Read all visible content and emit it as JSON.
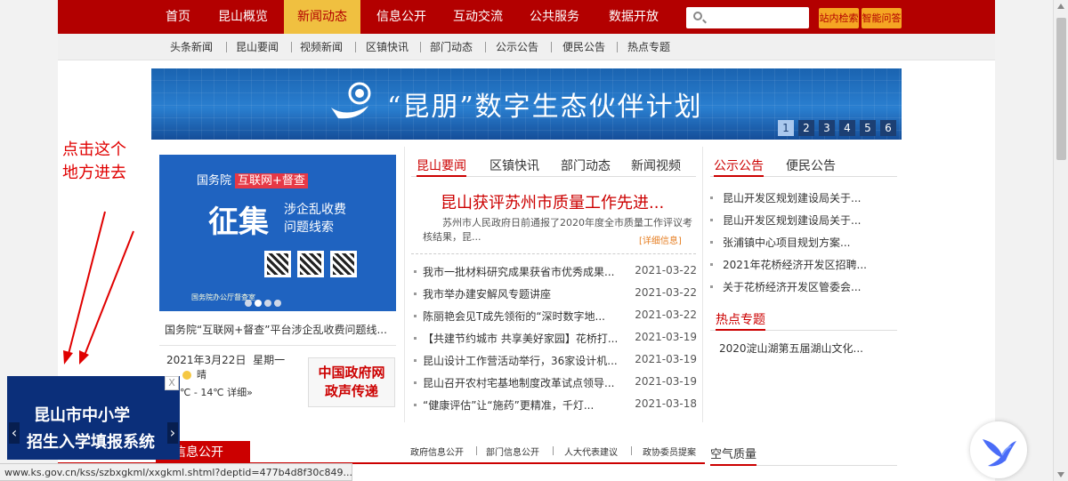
{
  "topnav": {
    "items": [
      "首页",
      "昆山概览",
      "新闻动态",
      "信息公开",
      "互动交流",
      "公共服务",
      "数据开放"
    ],
    "active_index": 2,
    "search_placeholder": "",
    "site_search": "站内检索",
    "doc_search": "智能问答"
  },
  "subnav": {
    "items": [
      "头条新闻",
      "昆山要闻",
      "视频新闻",
      "区镇快讯",
      "部门动态",
      "公示公告",
      "便民公告",
      "热点专题"
    ]
  },
  "banner": {
    "title": "“昆朋”数字生态伙伴计划",
    "pages": [
      "1",
      "2",
      "3",
      "4",
      "5",
      "6"
    ],
    "active_page": 1
  },
  "poster": {
    "org": "国务院",
    "tag": "互联网+督查",
    "big": "征集",
    "sub1": "涉企乱收费",
    "sub2": "问题线索",
    "footer": "国务院办公厅督查室",
    "caption": "国务院“互联网+督查”平台涉企乱收费问题线...",
    "slide_count": 4,
    "active_slide": 2
  },
  "date": {
    "text": "2021年3月22日",
    "weekday": "星期一",
    "weather": "晴",
    "temp": "4℃ - 14℃",
    "detail": "详细»"
  },
  "gov_button": {
    "line1": "中国政府网",
    "line2": "政声传递"
  },
  "news": {
    "tabs": [
      "昆山要闻",
      "区镇快讯",
      "部门动态",
      "新闻视频"
    ],
    "active_tab": 0,
    "headline": "昆山获评苏州市质量工作先进...",
    "summary": "苏州市人民政府日前通报了2020年度全市质量工作评议考核结果，昆...",
    "more": "[详细信息]",
    "items": [
      {
        "title": "我市一批材料研究成果获省市优秀成果...",
        "date": "2021-03-22"
      },
      {
        "title": "我市举办建安解风专题讲座",
        "date": "2021-03-22"
      },
      {
        "title": "陈丽艳会见T成先领衔的“深时数字地...",
        "date": "2021-03-22"
      },
      {
        "title": "【共建节约城市 共享美好家园】花桥打...",
        "date": "2021-03-19"
      },
      {
        "title": "昆山设计工作营活动举行，36家设计机...",
        "date": "2021-03-19"
      },
      {
        "title": "昆山召开农村宅基地制度改革试点领导...",
        "date": "2021-03-19"
      },
      {
        "title": "“健康评估”让“施药”更精准，千灯...",
        "date": "2021-03-18"
      }
    ]
  },
  "notices": {
    "tabs": [
      "公示公告",
      "便民公告"
    ],
    "active_tab": 0,
    "items": [
      "昆山开发区规划建设局关于...",
      "昆山开发区规划建设局关于...",
      "张浦镇中心项目规划方案...",
      "2021年花桥经济开发区招聘...",
      "关于花桥经济开发区管委会..."
    ]
  },
  "hot": {
    "title": "热点专题",
    "item": "2020淀山湖第五届湖山文化..."
  },
  "info_bar": {
    "label": "信息公开",
    "links": [
      "政府信息公开",
      "部门信息公开",
      "人大代表建议",
      "政协委员提案"
    ]
  },
  "air": {
    "title": "空气质量"
  },
  "annotation": {
    "line1": "点击这个",
    "line2": "地方进去"
  },
  "float_ad": {
    "line1": "昆山市中小学",
    "line2": "招生入学填报系统",
    "close": "X",
    "prev": "‹",
    "next": "›"
  },
  "statusbar": {
    "url": "www.ks.gov.cn/kss/szbxgkml/xxgkml.shtml?deptid=477b4d8f30c849..."
  },
  "colors": {
    "brand_red": "#b30000",
    "accent_gold": "#f0c040",
    "button_orange": "#f5a623",
    "banner_blue": "#1a63b0"
  }
}
